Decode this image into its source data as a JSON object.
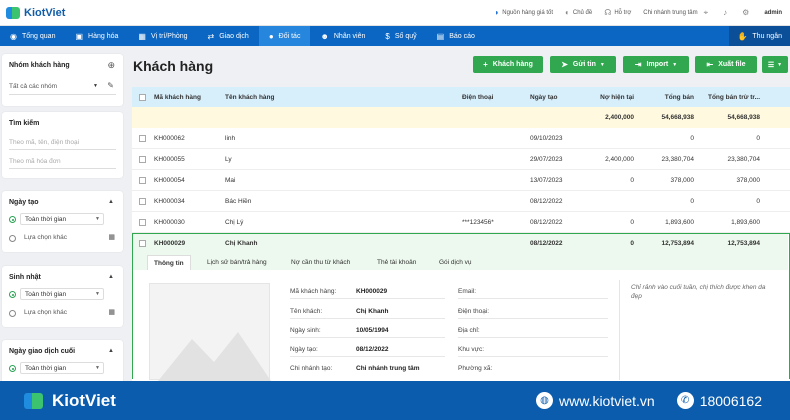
{
  "app": {
    "name": "KiotViet"
  },
  "topbar": {
    "source_label": "Nguồn hàng giá tốt",
    "theme_label": "Chủ đề",
    "support_label": "Hỗ trợ",
    "branch_label": "Chi nhánh trung tâm",
    "user_label": "admin"
  },
  "nav": {
    "items": [
      "Tổng quan",
      "Hàng hóa",
      "Vị trí/Phòng",
      "Giao dịch",
      "Đối tác",
      "Nhân viên",
      "Sổ quỹ",
      "Báo cáo"
    ],
    "cashier": "Thu ngân"
  },
  "sidebar": {
    "group": {
      "title": "Nhóm khách hàng",
      "value": "Tất cả các nhóm"
    },
    "search": {
      "title": "Tìm kiếm",
      "placeholder1": "Theo mã, tên, điện thoại",
      "placeholder2": "Theo mã hóa đơn"
    },
    "created": {
      "title": "Ngày tạo",
      "opt1": "Toàn thời gian",
      "opt2": "Lựa chọn khác"
    },
    "birthday": {
      "title": "Sinh nhật",
      "opt1": "Toàn thời gian",
      "opt2": "Lựa chọn khác"
    },
    "lasttx": {
      "title": "Ngày giao dịch cuối",
      "opt1": "Toàn thời gian"
    }
  },
  "main": {
    "title": "Khách hàng",
    "buttons": {
      "add": "Khách hàng",
      "send": "Gửi tin",
      "import": "Import",
      "export": "Xuất file"
    },
    "columns": [
      "Mã khách hàng",
      "Tên khách hàng",
      "Điện thoại",
      "Ngày tạo",
      "Nợ hiện tại",
      "Tổng bán",
      "Tổng bán trừ tr..."
    ],
    "summary": {
      "debt": "2,400,000",
      "total": "54,668,938",
      "net": "54,668,938"
    },
    "rows": [
      {
        "code": "KH000062",
        "name": "linh",
        "phone": "",
        "date": "09/10/2023",
        "debt": "",
        "total": "0",
        "net": "0"
      },
      {
        "code": "KH000055",
        "name": "Ly",
        "phone": "",
        "date": "29/07/2023",
        "debt": "2,400,000",
        "total": "23,380,704",
        "net": "23,380,704"
      },
      {
        "code": "KH000054",
        "name": "Mai",
        "phone": "",
        "date": "13/07/2023",
        "debt": "0",
        "total": "378,000",
        "net": "378,000"
      },
      {
        "code": "KH000034",
        "name": "Bác Hiền",
        "phone": "",
        "date": "08/12/2022",
        "debt": "",
        "total": "0",
        "net": "0"
      },
      {
        "code": "KH000030",
        "name": "Chị Lý",
        "phone": "***123456*",
        "date": "08/12/2022",
        "debt": "0",
        "total": "1,893,600",
        "net": "1,893,600"
      }
    ],
    "selected": {
      "code": "KH000029",
      "name": "Chị Khanh",
      "phone": "",
      "date": "08/12/2022",
      "debt": "0",
      "total": "12,753,894",
      "net": "12,753,894"
    },
    "tabs": [
      "Thông tin",
      "Lịch sử bán/trả hàng",
      "Nợ cần thu từ khách",
      "Thẻ tài khoản",
      "Gói dịch vụ"
    ],
    "detail": {
      "labels": [
        "Mã khách hàng:",
        "Tên khách:",
        "Ngày sinh:",
        "Ngày tạo:",
        "Chi nhánh tạo:"
      ],
      "values": [
        "KH000029",
        "Chị Khanh",
        "10/05/1994",
        "08/12/2022",
        "Chi nhánh trung tâm"
      ],
      "labels2": [
        "Email:",
        "Điện thoại:",
        "Địa chỉ:",
        "Khu vực:",
        "Phường xã:"
      ],
      "note": "Chỉ rảnh vào cuối tuần, chị thích được khen da đẹp"
    }
  },
  "footer": {
    "brand": "KiotViet",
    "website": "www.kiotviet.vn",
    "phone": "18006162"
  },
  "colors": {
    "primary": "#0a66c2",
    "green": "#31a84f",
    "header_row": "#d7eefb"
  }
}
